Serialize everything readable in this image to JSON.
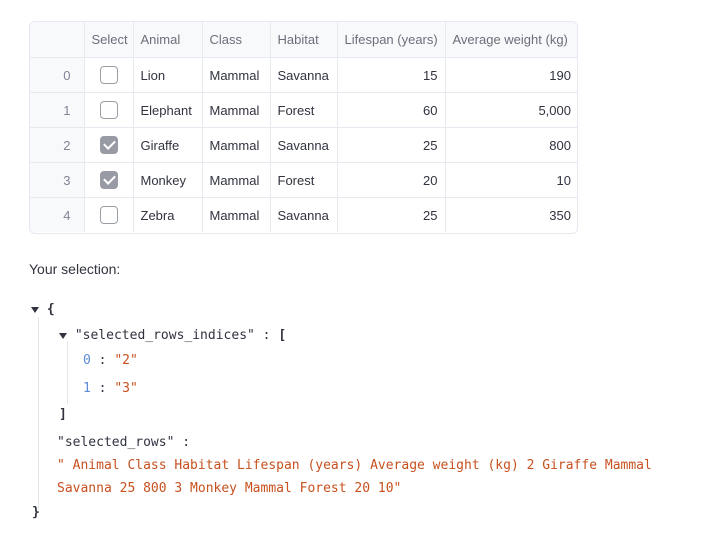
{
  "table": {
    "columns": [
      "",
      "Select",
      "Animal",
      "Class",
      "Habitat",
      "Lifespan (years)",
      "Average weight (kg)"
    ],
    "rows": [
      {
        "index": "0",
        "selected": false,
        "animal": "Lion",
        "class": "Mammal",
        "habitat": "Savanna",
        "lifespan": "15",
        "weight": "190"
      },
      {
        "index": "1",
        "selected": false,
        "animal": "Elephant",
        "class": "Mammal",
        "habitat": "Forest",
        "lifespan": "60",
        "weight": "5,000"
      },
      {
        "index": "2",
        "selected": true,
        "animal": "Giraffe",
        "class": "Mammal",
        "habitat": "Savanna",
        "lifespan": "25",
        "weight": "800"
      },
      {
        "index": "3",
        "selected": true,
        "animal": "Monkey",
        "class": "Mammal",
        "habitat": "Forest",
        "lifespan": "20",
        "weight": "10"
      },
      {
        "index": "4",
        "selected": false,
        "animal": "Zebra",
        "class": "Mammal",
        "habitat": "Savanna",
        "lifespan": "25",
        "weight": "350"
      }
    ]
  },
  "selection_label": "Your selection:",
  "json_view": {
    "open_brace": "{",
    "close_brace": "}",
    "indices_key": "\"selected_rows_indices\"",
    "colon": ":",
    "open_bracket": "[",
    "close_bracket": "]",
    "indices": [
      {
        "i": "0",
        "value": "\"2\""
      },
      {
        "i": "1",
        "value": "\"3\""
      }
    ],
    "rows_key": "\"selected_rows\"",
    "rows_value_line1": "\" Animal Class Habitat Lifespan (years) Average weight (kg) 2 Giraffe Mammal",
    "rows_value_line2": "Savanna 25 800 3 Monkey Mammal Forest 20 10\""
  }
}
